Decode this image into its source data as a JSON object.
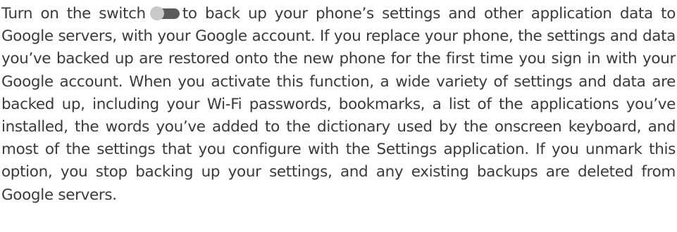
{
  "paragraph": {
    "before_switch": "Turn on the switch",
    "after_switch": "to back up your phone’s settings and other application data to Google servers, with your Google account. If you replace your phone, the settings and data you’ve backed up are restored onto the new phone for the first time you sign in with your Google account. When you activate this function, a wide variety of settings and data are backed up, including your Wi-Fi passwords, bookmarks, a list of the applications you’ve installed, the words you’ve added to the dictionary used by the onscreen keyboard, and most of the settings that you configure with the Settings application. If you unmark this option, you stop backing up your settings, and any existing backups are deleted from Google servers."
  },
  "switch_icon": {
    "icon": "toggle-switch-icon",
    "state": "off",
    "track_color": "#5b5b5b",
    "knob_color": "#c9c9c9"
  },
  "text_color": "#3a3a3a"
}
